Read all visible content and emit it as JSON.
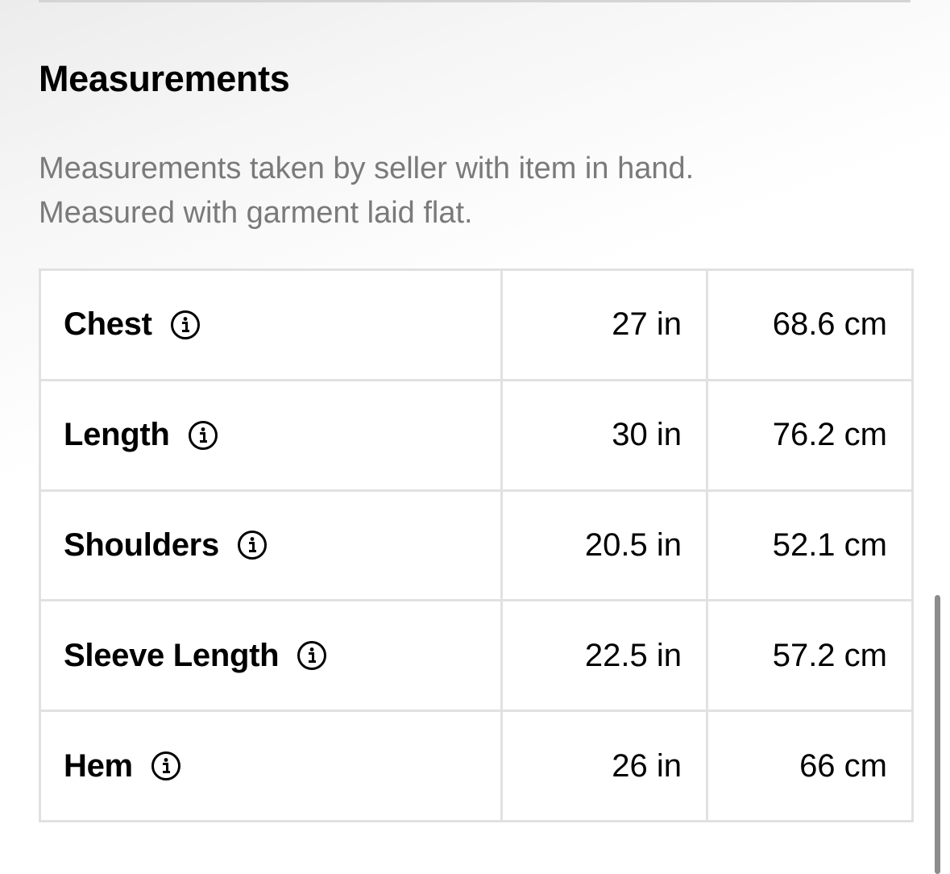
{
  "section": {
    "title": "Measurements",
    "description_lines": [
      "Measurements taken by seller with item in hand.",
      "Measured with garment laid flat."
    ]
  },
  "rows": [
    {
      "label": "Chest",
      "inches": "27 in",
      "cm": "68.6 cm",
      "icon": "info-icon"
    },
    {
      "label": "Length",
      "inches": "30 in",
      "cm": "76.2 cm",
      "icon": "info-icon"
    },
    {
      "label": "Shoulders",
      "inches": "20.5 in",
      "cm": "52.1 cm",
      "icon": "info-icon"
    },
    {
      "label": "Sleeve Length",
      "inches": "22.5 in",
      "cm": "57.2 cm",
      "icon": "info-icon"
    },
    {
      "label": "Hem",
      "inches": "26 in",
      "cm": "66 cm",
      "icon": "info-icon"
    }
  ],
  "colors": {
    "text_primary": "#000000",
    "text_secondary": "#7a7a7a",
    "border": "#e1e1e1",
    "scrollbar": "#8c8c8c"
  }
}
